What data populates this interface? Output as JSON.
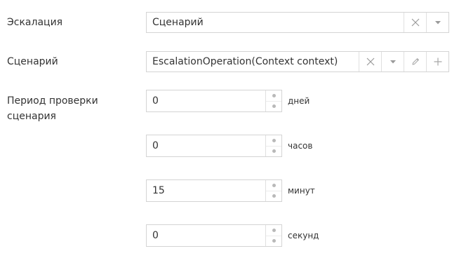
{
  "escalation": {
    "label": "Эскалация",
    "value": "Сценарий"
  },
  "scenario": {
    "label": "Сценарий",
    "value": "EscalationOperation(Context context)"
  },
  "check_period": {
    "label_line1": "Период проверки",
    "label_line2": "сценария",
    "fields": [
      {
        "value": "0",
        "unit": "дней"
      },
      {
        "value": "0",
        "unit": "часов"
      },
      {
        "value": "15",
        "unit": "минут"
      },
      {
        "value": "0",
        "unit": "секунд"
      }
    ]
  },
  "icons": {
    "clear": "close-icon",
    "dropdown": "caret-down-icon",
    "edit": "pencil-icon",
    "add": "plus-icon",
    "spin_up": "spin-up-dot-icon",
    "spin_down": "spin-down-dot-icon"
  },
  "colors": {
    "border": "#d4d4d4",
    "icon": "#9a9a9a",
    "text": "#333333"
  }
}
